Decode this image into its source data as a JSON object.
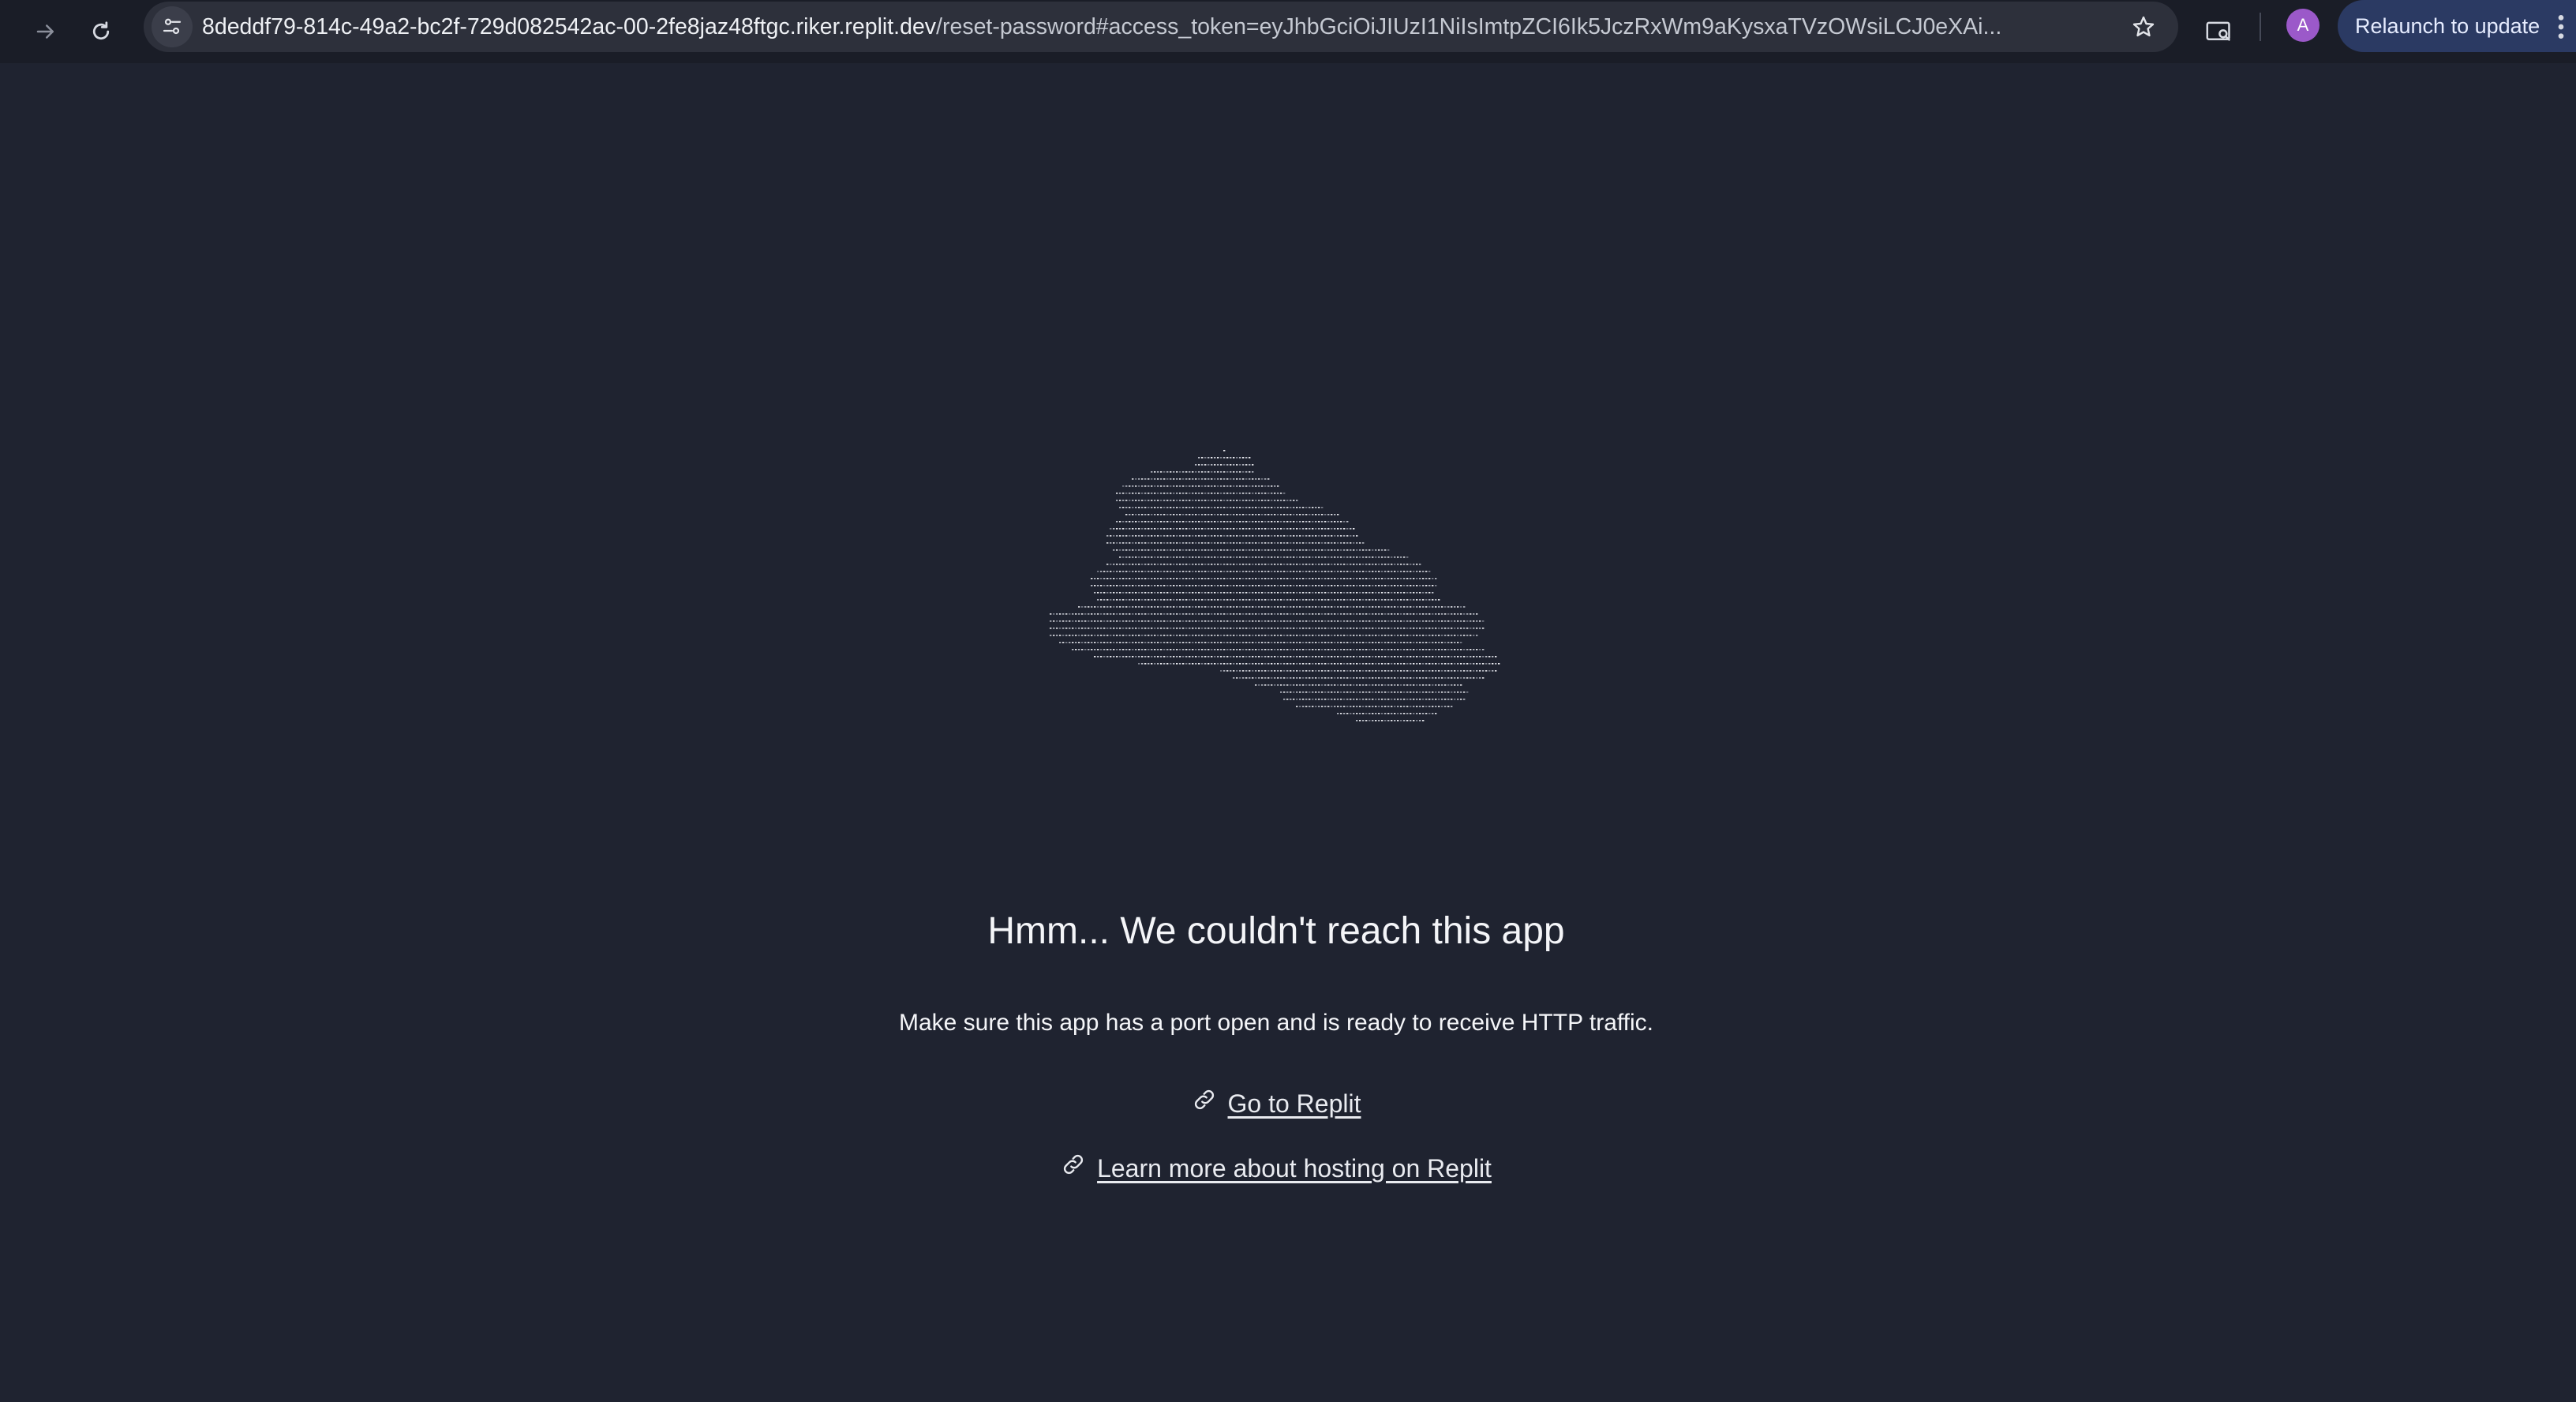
{
  "browser": {
    "url_host": "8deddf79-814c-49a2-bc2f-729d082542ac-00-2fe8jaz48ftgc.riker.replit.dev",
    "url_path": "/reset-password#access_token=eyJhbGciOiJIUzI1NiIsImtpZCI6Ik5JczRxWm9aKysxaTVzOWsiLCJ0eXAi...",
    "profile_initial": "A",
    "relaunch_label": "Relaunch to update",
    "icons": [
      "forward-arrow-icon",
      "reload-icon",
      "site-info-icon",
      "bookmark-star-icon",
      "extension-icon",
      "more-menu-icon"
    ]
  },
  "page": {
    "headline": "Hmm... We couldn't reach this app",
    "message": "Make sure this app has a port open and is ready to receive HTTP traffic.",
    "links": [
      {
        "label": "Go to Replit",
        "icon": "link-icon"
      },
      {
        "label": "Learn more about hosting on Replit",
        "icon": "link-icon"
      }
    ]
  },
  "colors": {
    "page_background": "#1f2330",
    "toolbar_background": "#1a1d27",
    "omnibox_background": "#2d303b",
    "relaunch_background": "#2b3a63",
    "avatar_background": "#9b59c9",
    "text": "#f4f5f8"
  }
}
